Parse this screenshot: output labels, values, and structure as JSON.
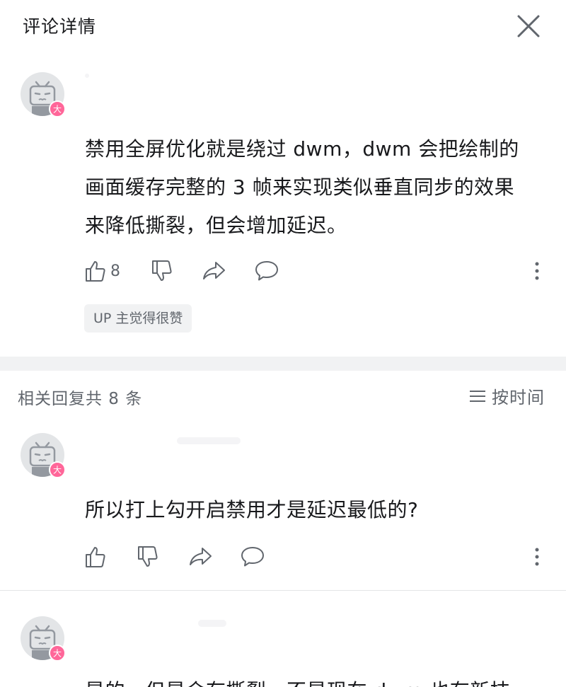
{
  "header": {
    "title": "评论详情"
  },
  "root_comment": {
    "text_lines": [
      "禁用全屏优化就是绕过 dwm，dwm 会把绘制的",
      "画面缓存完整的 3 帧来实现类似垂直同步的效果",
      "来降低撕裂，但会增加延迟。"
    ],
    "like_count": "8",
    "up_tag": "UP 主觉得很赞",
    "badge_text": "大"
  },
  "replies_header": {
    "count_label": "相关回复共 8 条",
    "sort_label": "按时间"
  },
  "replies": [
    {
      "text": "所以打上勾开启禁用才是延迟最低的?",
      "badge_text": "大"
    },
    {
      "text": "是的，但是会有撕裂，不是现在 dwm 也有新技",
      "badge_text": "大"
    }
  ],
  "icons": {
    "like": "thumbs-up-icon",
    "dislike": "thumbs-down-icon",
    "share": "share-icon",
    "reply": "comment-bubble-icon",
    "more": "more-vertical-icon",
    "sort": "list-icon",
    "close": "close-icon"
  },
  "colors": {
    "text_primary": "#18191c",
    "text_secondary": "#61666d",
    "badge_pink": "#ff6699",
    "divider": "#f1f2f3"
  }
}
